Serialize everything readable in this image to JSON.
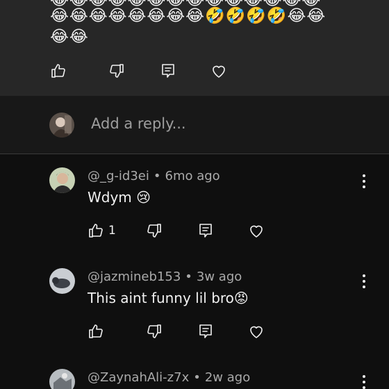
{
  "top_comment": {
    "emoji_lines": [
      "😂😂😂😂😂😂😂😂😂😂😂😂😂😂",
      "😂😂😂😂😂😂😂😂🤣🤣🤣🤣😂😂",
      "😂😂"
    ]
  },
  "reply": {
    "placeholder": "Add a reply..."
  },
  "comments": [
    {
      "author": "@_g-id3ei",
      "age": "6mo ago",
      "text": "Wdym 😢",
      "like_count": "1"
    },
    {
      "author": "@jazmineb153",
      "age": "3w ago",
      "text": "This aint funny lil bro😡",
      "like_count": ""
    },
    {
      "author": "@ZaynahAli-z7x",
      "age": "2w ago",
      "text": "",
      "like_count": ""
    }
  ],
  "separator": "•",
  "icons": [
    "like-icon",
    "dislike-icon",
    "reply-icon",
    "heart-icon",
    "more-options-icon"
  ]
}
